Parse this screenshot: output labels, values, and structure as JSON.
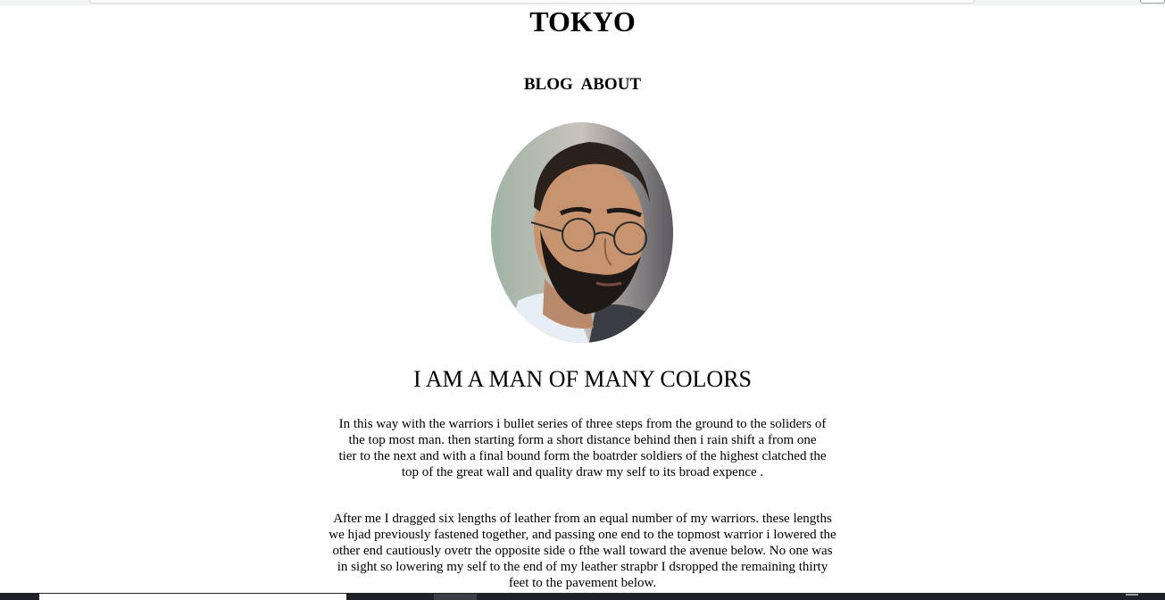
{
  "site": {
    "title": "TOKYO"
  },
  "nav": {
    "items": [
      {
        "label": "BLOG"
      },
      {
        "label": "ABOUT"
      }
    ]
  },
  "hero": {
    "tagline": "I AM A MAN OF MANY COLORS",
    "avatar_icon": "profile-photo"
  },
  "content": {
    "paragraphs": [
      "In this way with the warriors i bullet series of three steps from the ground to the soliders of the top most man. then starting form a short distance behind then i rain shift a from one tier to the next and with a final bound form the boatrder soldiers of the highest clatched the top of the great wall and quality draw my self to its broad expence .",
      "After me I dragged six lengths of leather from an equal number of my warriors. these lengths we hjad previously fastened together, and passing one end to the topmost warrior i lowered the other end cautiously ovetr the opposite side o fthe wall toward the avenue below. No one was in sight so lowering my self to the end of my leather strapbr I dsropped the remaining thirty feet to the pavement below."
    ]
  },
  "colors": {
    "background": "#ffffff",
    "text": "#000000",
    "taskbar": "#1f2328"
  }
}
